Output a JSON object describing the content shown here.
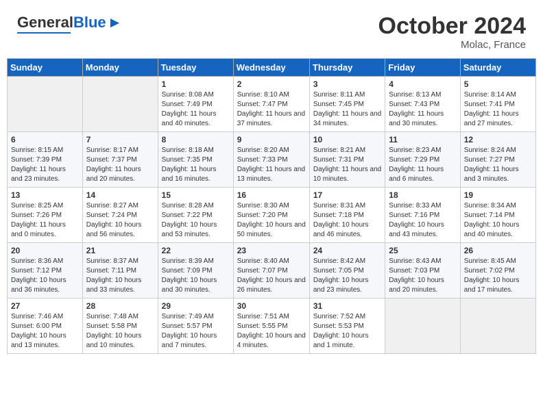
{
  "header": {
    "logo_general": "General",
    "logo_blue": "Blue",
    "month_title": "October 2024",
    "location": "Molac, France"
  },
  "days_of_week": [
    "Sunday",
    "Monday",
    "Tuesday",
    "Wednesday",
    "Thursday",
    "Friday",
    "Saturday"
  ],
  "weeks": [
    [
      {
        "day": "",
        "info": ""
      },
      {
        "day": "",
        "info": ""
      },
      {
        "day": "1",
        "info": "Sunrise: 8:08 AM\nSunset: 7:49 PM\nDaylight: 11 hours and 40 minutes."
      },
      {
        "day": "2",
        "info": "Sunrise: 8:10 AM\nSunset: 7:47 PM\nDaylight: 11 hours and 37 minutes."
      },
      {
        "day": "3",
        "info": "Sunrise: 8:11 AM\nSunset: 7:45 PM\nDaylight: 11 hours and 34 minutes."
      },
      {
        "day": "4",
        "info": "Sunrise: 8:13 AM\nSunset: 7:43 PM\nDaylight: 11 hours and 30 minutes."
      },
      {
        "day": "5",
        "info": "Sunrise: 8:14 AM\nSunset: 7:41 PM\nDaylight: 11 hours and 27 minutes."
      }
    ],
    [
      {
        "day": "6",
        "info": "Sunrise: 8:15 AM\nSunset: 7:39 PM\nDaylight: 11 hours and 23 minutes."
      },
      {
        "day": "7",
        "info": "Sunrise: 8:17 AM\nSunset: 7:37 PM\nDaylight: 11 hours and 20 minutes."
      },
      {
        "day": "8",
        "info": "Sunrise: 8:18 AM\nSunset: 7:35 PM\nDaylight: 11 hours and 16 minutes."
      },
      {
        "day": "9",
        "info": "Sunrise: 8:20 AM\nSunset: 7:33 PM\nDaylight: 11 hours and 13 minutes."
      },
      {
        "day": "10",
        "info": "Sunrise: 8:21 AM\nSunset: 7:31 PM\nDaylight: 11 hours and 10 minutes."
      },
      {
        "day": "11",
        "info": "Sunrise: 8:23 AM\nSunset: 7:29 PM\nDaylight: 11 hours and 6 minutes."
      },
      {
        "day": "12",
        "info": "Sunrise: 8:24 AM\nSunset: 7:27 PM\nDaylight: 11 hours and 3 minutes."
      }
    ],
    [
      {
        "day": "13",
        "info": "Sunrise: 8:25 AM\nSunset: 7:26 PM\nDaylight: 11 hours and 0 minutes."
      },
      {
        "day": "14",
        "info": "Sunrise: 8:27 AM\nSunset: 7:24 PM\nDaylight: 10 hours and 56 minutes."
      },
      {
        "day": "15",
        "info": "Sunrise: 8:28 AM\nSunset: 7:22 PM\nDaylight: 10 hours and 53 minutes."
      },
      {
        "day": "16",
        "info": "Sunrise: 8:30 AM\nSunset: 7:20 PM\nDaylight: 10 hours and 50 minutes."
      },
      {
        "day": "17",
        "info": "Sunrise: 8:31 AM\nSunset: 7:18 PM\nDaylight: 10 hours and 46 minutes."
      },
      {
        "day": "18",
        "info": "Sunrise: 8:33 AM\nSunset: 7:16 PM\nDaylight: 10 hours and 43 minutes."
      },
      {
        "day": "19",
        "info": "Sunrise: 8:34 AM\nSunset: 7:14 PM\nDaylight: 10 hours and 40 minutes."
      }
    ],
    [
      {
        "day": "20",
        "info": "Sunrise: 8:36 AM\nSunset: 7:12 PM\nDaylight: 10 hours and 36 minutes."
      },
      {
        "day": "21",
        "info": "Sunrise: 8:37 AM\nSunset: 7:11 PM\nDaylight: 10 hours and 33 minutes."
      },
      {
        "day": "22",
        "info": "Sunrise: 8:39 AM\nSunset: 7:09 PM\nDaylight: 10 hours and 30 minutes."
      },
      {
        "day": "23",
        "info": "Sunrise: 8:40 AM\nSunset: 7:07 PM\nDaylight: 10 hours and 26 minutes."
      },
      {
        "day": "24",
        "info": "Sunrise: 8:42 AM\nSunset: 7:05 PM\nDaylight: 10 hours and 23 minutes."
      },
      {
        "day": "25",
        "info": "Sunrise: 8:43 AM\nSunset: 7:03 PM\nDaylight: 10 hours and 20 minutes."
      },
      {
        "day": "26",
        "info": "Sunrise: 8:45 AM\nSunset: 7:02 PM\nDaylight: 10 hours and 17 minutes."
      }
    ],
    [
      {
        "day": "27",
        "info": "Sunrise: 7:46 AM\nSunset: 6:00 PM\nDaylight: 10 hours and 13 minutes."
      },
      {
        "day": "28",
        "info": "Sunrise: 7:48 AM\nSunset: 5:58 PM\nDaylight: 10 hours and 10 minutes."
      },
      {
        "day": "29",
        "info": "Sunrise: 7:49 AM\nSunset: 5:57 PM\nDaylight: 10 hours and 7 minutes."
      },
      {
        "day": "30",
        "info": "Sunrise: 7:51 AM\nSunset: 5:55 PM\nDaylight: 10 hours and 4 minutes."
      },
      {
        "day": "31",
        "info": "Sunrise: 7:52 AM\nSunset: 5:53 PM\nDaylight: 10 hours and 1 minute."
      },
      {
        "day": "",
        "info": ""
      },
      {
        "day": "",
        "info": ""
      }
    ]
  ]
}
